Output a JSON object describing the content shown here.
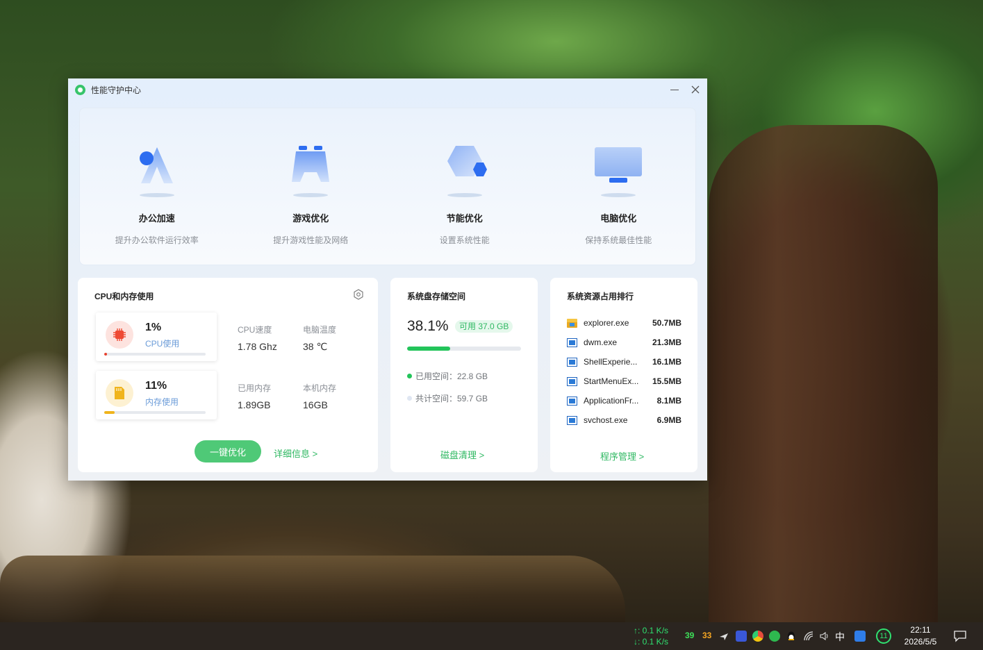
{
  "window": {
    "title": "性能守护中心"
  },
  "hero": {
    "items": [
      {
        "name": "办公加速",
        "desc": "提升办公软件运行效率",
        "icon": "office-boost-icon"
      },
      {
        "name": "游戏优化",
        "desc": "提升游戏性能及网络",
        "icon": "gamepad-icon"
      },
      {
        "name": "节能优化",
        "desc": "设置系统性能",
        "icon": "energy-hexagon-icon"
      },
      {
        "name": "电脑优化",
        "desc": "保持系统最佳性能",
        "icon": "monitor-icon"
      }
    ]
  },
  "cpu_card": {
    "title": "CPU和内存使用",
    "cpu": {
      "value": "1%",
      "label": "CPU使用",
      "usage": 0.03
    },
    "mem": {
      "value": "11%",
      "label": "内存使用",
      "usage": 0.1
    },
    "stats": {
      "cpu_speed_label": "CPU速度",
      "cpu_speed_value": "1.78 Ghz",
      "temp_label": "电脑温度",
      "temp_value": "38 ℃",
      "used_mem_label": "已用内存",
      "used_mem_value": "1.89GB",
      "total_mem_label": "本机内存",
      "total_mem_value": "16GB"
    },
    "optimize_button": "一键优化",
    "details_link": "详细信息 >"
  },
  "disk_card": {
    "title": "系统盘存储空间",
    "percent": "38.1%",
    "usage": 0.381,
    "available": "可用 37.0 GB",
    "used_label": "已用空间：22.8 GB",
    "total_label": "共计空间：59.7 GB",
    "clean_link": "磁盘清理 >",
    "used_color": "#23c45a",
    "total_color": "#dfe6f2"
  },
  "rank_card": {
    "title": "系统资源占用排行",
    "rows": [
      {
        "name": "explorer.exe",
        "mem": "50.7MB",
        "icon": "folder-icon"
      },
      {
        "name": "dwm.exe",
        "mem": "21.3MB",
        "icon": "app-window-icon"
      },
      {
        "name": "ShellExperie...",
        "mem": "16.1MB",
        "icon": "app-window-icon"
      },
      {
        "name": "StartMenuEx...",
        "mem": "15.5MB",
        "icon": "app-window-icon"
      },
      {
        "name": "ApplicationFr...",
        "mem": "8.1MB",
        "icon": "app-window-icon"
      },
      {
        "name": "svchost.exe",
        "mem": "6.9MB",
        "icon": "app-window-icon"
      }
    ],
    "manage_link": "程序管理 >"
  },
  "taskbar": {
    "net_up": "↑: 0.1 K/s",
    "net_down": "↓: 0.1 K/s",
    "temp_a": "39",
    "temp_b": "33",
    "ime": "中",
    "badge": "11",
    "time": "22:11",
    "date": "2026/5/5"
  }
}
